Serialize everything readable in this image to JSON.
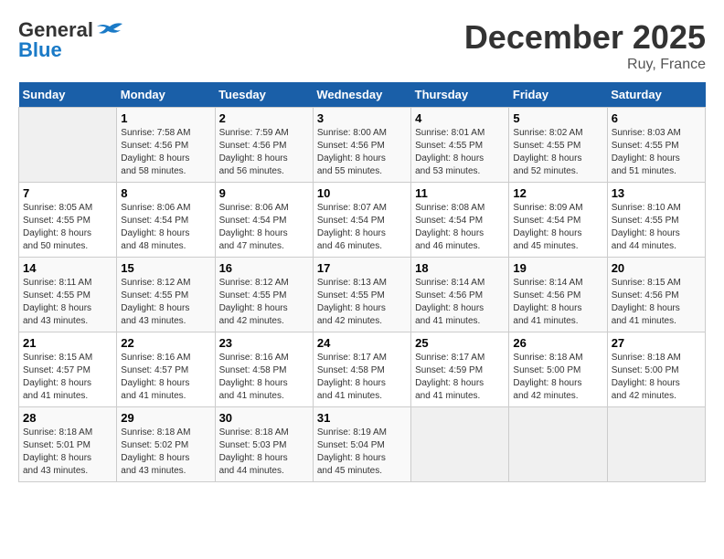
{
  "logo": {
    "line1": "General",
    "line2": "Blue"
  },
  "title": "December 2025",
  "location": "Ruy, France",
  "days_of_week": [
    "Sunday",
    "Monday",
    "Tuesday",
    "Wednesday",
    "Thursday",
    "Friday",
    "Saturday"
  ],
  "weeks": [
    [
      {
        "day": "",
        "info": ""
      },
      {
        "day": "1",
        "info": "Sunrise: 7:58 AM\nSunset: 4:56 PM\nDaylight: 8 hours\nand 58 minutes."
      },
      {
        "day": "2",
        "info": "Sunrise: 7:59 AM\nSunset: 4:56 PM\nDaylight: 8 hours\nand 56 minutes."
      },
      {
        "day": "3",
        "info": "Sunrise: 8:00 AM\nSunset: 4:56 PM\nDaylight: 8 hours\nand 55 minutes."
      },
      {
        "day": "4",
        "info": "Sunrise: 8:01 AM\nSunset: 4:55 PM\nDaylight: 8 hours\nand 53 minutes."
      },
      {
        "day": "5",
        "info": "Sunrise: 8:02 AM\nSunset: 4:55 PM\nDaylight: 8 hours\nand 52 minutes."
      },
      {
        "day": "6",
        "info": "Sunrise: 8:03 AM\nSunset: 4:55 PM\nDaylight: 8 hours\nand 51 minutes."
      }
    ],
    [
      {
        "day": "7",
        "info": "Sunrise: 8:05 AM\nSunset: 4:55 PM\nDaylight: 8 hours\nand 50 minutes."
      },
      {
        "day": "8",
        "info": "Sunrise: 8:06 AM\nSunset: 4:54 PM\nDaylight: 8 hours\nand 48 minutes."
      },
      {
        "day": "9",
        "info": "Sunrise: 8:06 AM\nSunset: 4:54 PM\nDaylight: 8 hours\nand 47 minutes."
      },
      {
        "day": "10",
        "info": "Sunrise: 8:07 AM\nSunset: 4:54 PM\nDaylight: 8 hours\nand 46 minutes."
      },
      {
        "day": "11",
        "info": "Sunrise: 8:08 AM\nSunset: 4:54 PM\nDaylight: 8 hours\nand 46 minutes."
      },
      {
        "day": "12",
        "info": "Sunrise: 8:09 AM\nSunset: 4:54 PM\nDaylight: 8 hours\nand 45 minutes."
      },
      {
        "day": "13",
        "info": "Sunrise: 8:10 AM\nSunset: 4:55 PM\nDaylight: 8 hours\nand 44 minutes."
      }
    ],
    [
      {
        "day": "14",
        "info": "Sunrise: 8:11 AM\nSunset: 4:55 PM\nDaylight: 8 hours\nand 43 minutes."
      },
      {
        "day": "15",
        "info": "Sunrise: 8:12 AM\nSunset: 4:55 PM\nDaylight: 8 hours\nand 43 minutes."
      },
      {
        "day": "16",
        "info": "Sunrise: 8:12 AM\nSunset: 4:55 PM\nDaylight: 8 hours\nand 42 minutes."
      },
      {
        "day": "17",
        "info": "Sunrise: 8:13 AM\nSunset: 4:55 PM\nDaylight: 8 hours\nand 42 minutes."
      },
      {
        "day": "18",
        "info": "Sunrise: 8:14 AM\nSunset: 4:56 PM\nDaylight: 8 hours\nand 41 minutes."
      },
      {
        "day": "19",
        "info": "Sunrise: 8:14 AM\nSunset: 4:56 PM\nDaylight: 8 hours\nand 41 minutes."
      },
      {
        "day": "20",
        "info": "Sunrise: 8:15 AM\nSunset: 4:56 PM\nDaylight: 8 hours\nand 41 minutes."
      }
    ],
    [
      {
        "day": "21",
        "info": "Sunrise: 8:15 AM\nSunset: 4:57 PM\nDaylight: 8 hours\nand 41 minutes."
      },
      {
        "day": "22",
        "info": "Sunrise: 8:16 AM\nSunset: 4:57 PM\nDaylight: 8 hours\nand 41 minutes."
      },
      {
        "day": "23",
        "info": "Sunrise: 8:16 AM\nSunset: 4:58 PM\nDaylight: 8 hours\nand 41 minutes."
      },
      {
        "day": "24",
        "info": "Sunrise: 8:17 AM\nSunset: 4:58 PM\nDaylight: 8 hours\nand 41 minutes."
      },
      {
        "day": "25",
        "info": "Sunrise: 8:17 AM\nSunset: 4:59 PM\nDaylight: 8 hours\nand 41 minutes."
      },
      {
        "day": "26",
        "info": "Sunrise: 8:18 AM\nSunset: 5:00 PM\nDaylight: 8 hours\nand 42 minutes."
      },
      {
        "day": "27",
        "info": "Sunrise: 8:18 AM\nSunset: 5:00 PM\nDaylight: 8 hours\nand 42 minutes."
      }
    ],
    [
      {
        "day": "28",
        "info": "Sunrise: 8:18 AM\nSunset: 5:01 PM\nDaylight: 8 hours\nand 43 minutes."
      },
      {
        "day": "29",
        "info": "Sunrise: 8:18 AM\nSunset: 5:02 PM\nDaylight: 8 hours\nand 43 minutes."
      },
      {
        "day": "30",
        "info": "Sunrise: 8:18 AM\nSunset: 5:03 PM\nDaylight: 8 hours\nand 44 minutes."
      },
      {
        "day": "31",
        "info": "Sunrise: 8:19 AM\nSunset: 5:04 PM\nDaylight: 8 hours\nand 45 minutes."
      },
      {
        "day": "",
        "info": ""
      },
      {
        "day": "",
        "info": ""
      },
      {
        "day": "",
        "info": ""
      }
    ]
  ]
}
